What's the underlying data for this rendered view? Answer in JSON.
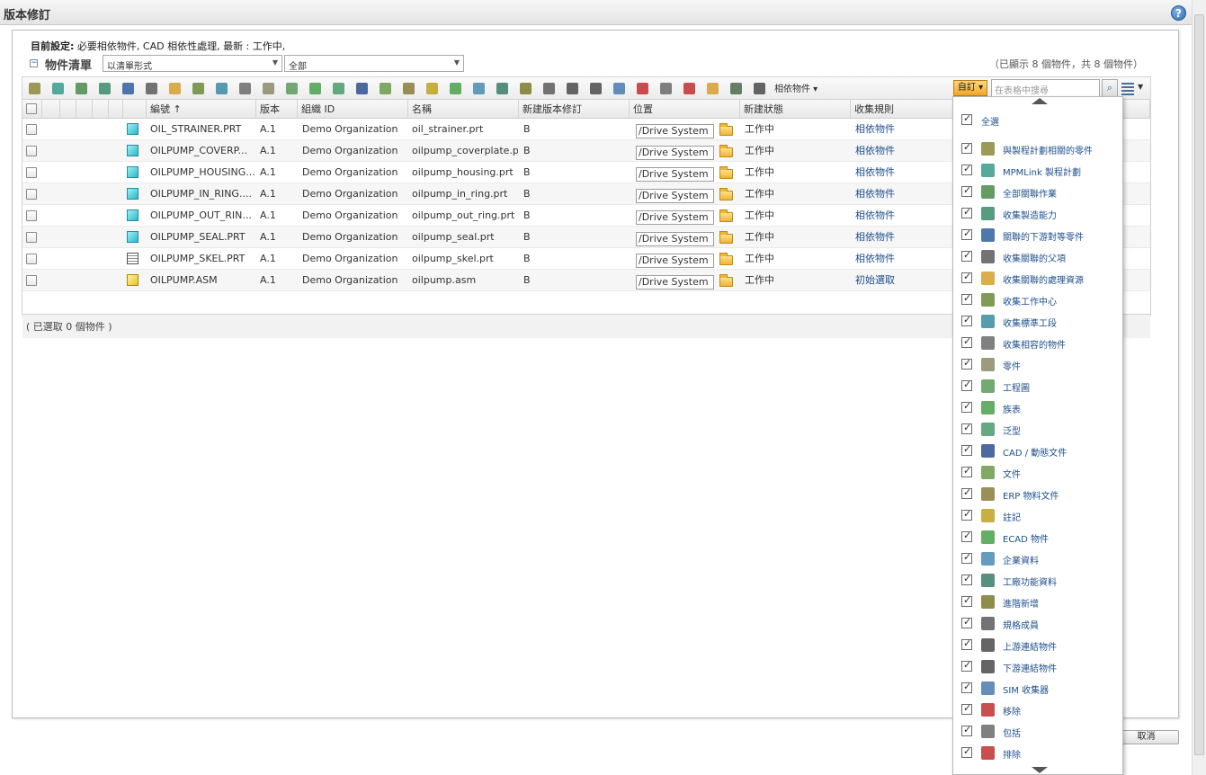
{
  "page": {
    "title": "版本修訂",
    "settings_label": "目前設定:",
    "settings_value": "必要相依物件, CAD 相依性處理, 最新 : 工作中,",
    "list_title": "物件清單",
    "view_select": "以清單形式",
    "filter_select": "全部",
    "count_text": "（已顯示 8 個物件，共 8 個物件）",
    "selected_count": "( 已選取 0 個物件 )",
    "cancel_label": "取消"
  },
  "toolbar": {
    "icons": [
      "gear-icon",
      "mpm-plan-icon",
      "all-operations-icon",
      "capability-icon",
      "downstream-equivalent-icon",
      "parent-icon",
      "process-resource-icon",
      "work-center-icon",
      "standard-operation-icon",
      "compatible-object-icon",
      "part-icon",
      "drawing-icon",
      "family-table-icon",
      "generic-icon",
      "cad-dynamic-doc-icon",
      "document-icon",
      "erp-doc-icon",
      "annotation-icon",
      "ecad-icon",
      "enterprise-data-icon",
      "plant-data-icon",
      "advanced-add-icon",
      "spec-member-icon",
      "upstream-link-icon",
      "downstream-link-icon",
      "sim-collector-icon",
      "remove-icon",
      "include-icon",
      "exclude-icon",
      "folder-open-icon",
      "edit-checklist-icon",
      "refresh-icon"
    ],
    "dependents_label": "相依物件",
    "custom_label": "自訂",
    "search_placeholder": "在表格中搜尋"
  },
  "columns": [
    "編號 ↑",
    "版本",
    "組織 ID",
    "名稱",
    "新建版本修訂",
    "位置",
    "新建狀態",
    "收集規則"
  ],
  "rows": [
    {
      "number": "OIL_STRAINER.PRT",
      "version": "A.1",
      "org": "Demo Organization",
      "name": "oil_strainer.prt",
      "new_rev": "B",
      "location": "/Drive System",
      "state": "工作中",
      "rule": "相依物件",
      "type": "part"
    },
    {
      "number": "OILPUMP_COVERP...",
      "version": "A.1",
      "org": "Demo Organization",
      "name": "oilpump_coverplate.prt",
      "new_rev": "B",
      "location": "/Drive System",
      "state": "工作中",
      "rule": "相依物件",
      "type": "part"
    },
    {
      "number": "OILPUMP_HOUSING...",
      "version": "A.1",
      "org": "Demo Organization",
      "name": "oilpump_housing.prt",
      "new_rev": "B",
      "location": "/Drive System",
      "state": "工作中",
      "rule": "相依物件",
      "type": "part"
    },
    {
      "number": "OILPUMP_IN_RING....",
      "version": "A.1",
      "org": "Demo Organization",
      "name": "oilpump_in_ring.prt",
      "new_rev": "B",
      "location": "/Drive System",
      "state": "工作中",
      "rule": "相依物件",
      "type": "part"
    },
    {
      "number": "OILPUMP_OUT_RIN...",
      "version": "A.1",
      "org": "Demo Organization",
      "name": "oilpump_out_ring.prt",
      "new_rev": "B",
      "location": "/Drive System",
      "state": "工作中",
      "rule": "相依物件",
      "type": "part"
    },
    {
      "number": "OILPUMP_SEAL.PRT",
      "version": "A.1",
      "org": "Demo Organization",
      "name": "oilpump_seal.prt",
      "new_rev": "B",
      "location": "/Drive System",
      "state": "工作中",
      "rule": "相依物件",
      "type": "part"
    },
    {
      "number": "OILPUMP_SKEL.PRT",
      "version": "A.1",
      "org": "Demo Organization",
      "name": "oilpump_skel.prt",
      "new_rev": "B",
      "location": "/Drive System",
      "state": "工作中",
      "rule": "相依物件",
      "type": "skeleton"
    },
    {
      "number": "OILPUMP.ASM",
      "version": "A.1",
      "org": "Demo Organization",
      "name": "oilpump.asm",
      "new_rev": "B",
      "location": "/Drive System",
      "state": "工作中",
      "rule": "初始選取",
      "type": "assembly"
    }
  ],
  "dropdown": {
    "select_all": "全選",
    "items": [
      {
        "label": "與製程計劃相關的零件",
        "icon": "gear-icon",
        "color": "#8a8a3a"
      },
      {
        "label": "MPMLink 製程計劃",
        "icon": "mpm-plan-icon",
        "color": "#3a9a8a"
      },
      {
        "label": "全部關聯作業",
        "icon": "all-operations-icon",
        "color": "#4a8a4a"
      },
      {
        "label": "收集製造能力",
        "icon": "capability-icon",
        "color": "#3a8a6a"
      },
      {
        "label": "關聯的下游對等零件",
        "icon": "downstream-equivalent-icon",
        "color": "#2f5f9f"
      },
      {
        "label": "收集關聯的父項",
        "icon": "parent-icon",
        "color": "#5a5a5a"
      },
      {
        "label": "收集關聯的處理資源",
        "icon": "process-resource-icon",
        "color": "#d4a030"
      },
      {
        "label": "收集工作中心",
        "icon": "work-center-icon",
        "color": "#6a8a3a"
      },
      {
        "label": "收集標準工段",
        "icon": "standard-operation-icon",
        "color": "#3a8aa0"
      },
      {
        "label": "收集相容的物件",
        "icon": "compatible-object-icon",
        "color": "#6a6a6a"
      },
      {
        "label": "零件",
        "icon": "part-icon",
        "color": "#8a8a6a"
      },
      {
        "label": "工程圖",
        "icon": "drawing-icon",
        "color": "#5a9a5a"
      },
      {
        "label": "族表",
        "icon": "family-table-icon",
        "color": "#4aa04a"
      },
      {
        "label": "泛型",
        "icon": "generic-icon",
        "color": "#4a9a6a"
      },
      {
        "label": "CAD / 動態文件",
        "icon": "cad-dynamic-doc-icon",
        "color": "#2f4f8f"
      },
      {
        "label": "文件",
        "icon": "document-icon",
        "color": "#6a9a4a"
      },
      {
        "label": "ERP 物料文件",
        "icon": "erp-doc-icon",
        "color": "#8a7a3a"
      },
      {
        "label": "註記",
        "icon": "annotation-icon",
        "color": "#c0a020"
      },
      {
        "label": "ECAD 物件",
        "icon": "ecad-icon",
        "color": "#4aa04a"
      },
      {
        "label": "企業資料",
        "icon": "enterprise-data-icon",
        "color": "#4a8ab0"
      },
      {
        "label": "工廠功能資料",
        "icon": "plant-data-icon",
        "color": "#3a7a6a"
      },
      {
        "label": "進階新增",
        "icon": "advanced-add-icon",
        "color": "#7a7a2a"
      },
      {
        "label": "規格成員",
        "icon": "spec-member-icon",
        "color": "#5a5a5a"
      },
      {
        "label": "上游連結物件",
        "icon": "upstream-link-icon",
        "color": "#4a4a4a"
      },
      {
        "label": "下游連結物件",
        "icon": "downstream-link-icon",
        "color": "#4a4a4a"
      },
      {
        "label": "SIM 收集器",
        "icon": "sim-collector-icon",
        "color": "#4a7ab0"
      },
      {
        "label": "移除",
        "icon": "remove-icon",
        "color": "#c03030"
      },
      {
        "label": "包括",
        "icon": "include-icon",
        "color": "#6a6a6a"
      },
      {
        "label": "排除",
        "icon": "exclude-icon",
        "color": "#c03030"
      }
    ]
  },
  "colors": {
    "accent": "#f0a62c",
    "link": "#1f4f8c",
    "part": "#2cb8c8",
    "assembly": "#e6c229"
  }
}
